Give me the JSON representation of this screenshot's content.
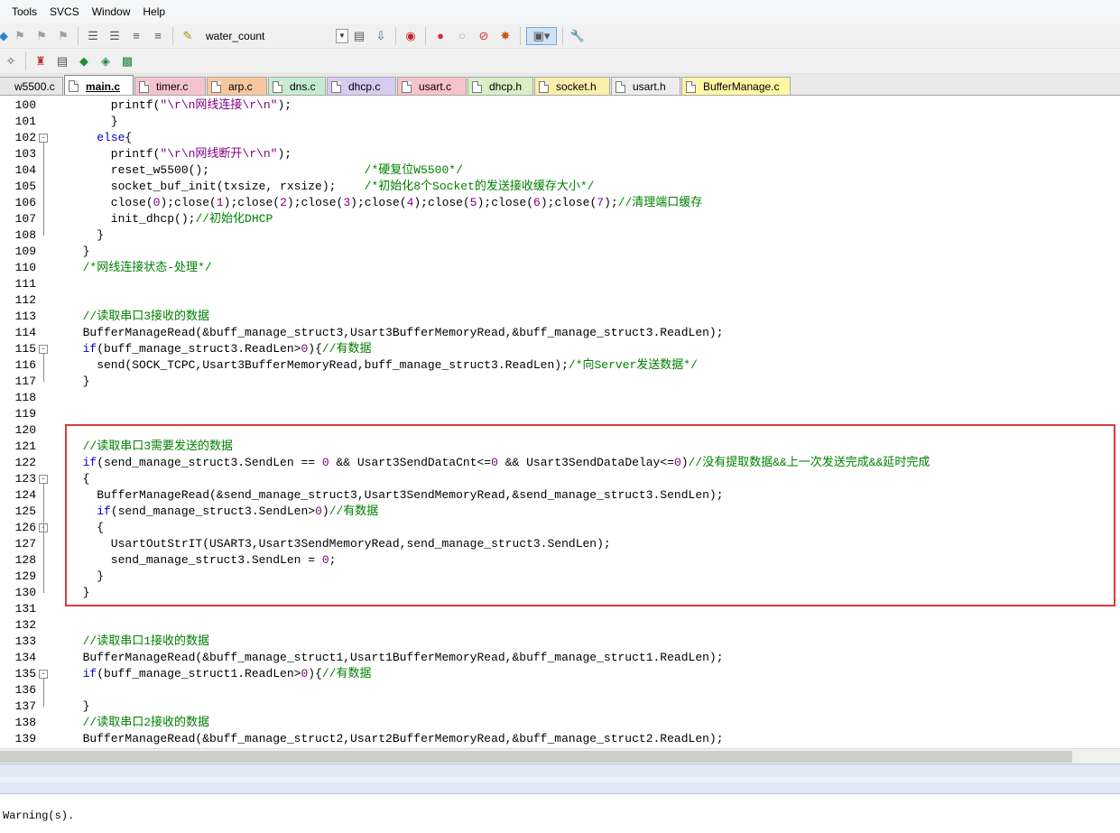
{
  "menu": [
    "Tools",
    "SVCS",
    "Window",
    "Help"
  ],
  "toolbar": {
    "target_name": "water_count"
  },
  "tabs": [
    {
      "label": "w5500.c",
      "color": "#e6e6e6"
    },
    {
      "label": "main.c",
      "color": "#ffffff",
      "active": true
    },
    {
      "label": "timer.c",
      "color": "#f3c4ce"
    },
    {
      "label": "arp.c",
      "color": "#f7c79f"
    },
    {
      "label": "dns.c",
      "color": "#c5ecd1"
    },
    {
      "label": "dhcp.c",
      "color": "#d7cbf0"
    },
    {
      "label": "usart.c",
      "color": "#f7c2c8"
    },
    {
      "label": "dhcp.h",
      "color": "#d8efc5"
    },
    {
      "label": "socket.h",
      "color": "#fbeeaa"
    },
    {
      "label": "usart.h",
      "color": "#ececec"
    },
    {
      "label": "BufferManage.c",
      "color": "#fff7a4"
    }
  ],
  "code": [
    {
      "n": "100",
      "segs": [
        [
          "      printf(",
          ""
        ],
        [
          "\"\\r\\n网线连接\\r\\n\"",
          "st"
        ],
        [
          ");",
          ""
        ]
      ]
    },
    {
      "n": "101",
      "segs": [
        [
          "      }",
          ""
        ]
      ]
    },
    {
      "n": "102",
      "fold": "-",
      "segs": [
        [
          "    ",
          ""
        ],
        [
          "else",
          "kw"
        ],
        [
          "{",
          ""
        ]
      ]
    },
    {
      "n": "103",
      "segs": [
        [
          "      printf(",
          ""
        ],
        [
          "\"\\r\\n网线断开\\r\\n\"",
          "st"
        ],
        [
          ");",
          ""
        ]
      ]
    },
    {
      "n": "104",
      "segs": [
        [
          "      reset_w5500();                      ",
          ""
        ],
        [
          "/*硬复位W5500*/",
          "cm"
        ]
      ]
    },
    {
      "n": "105",
      "segs": [
        [
          "      socket_buf_init(txsize, rxsize);    ",
          ""
        ],
        [
          "/*初始化8个Socket的发送接收缓存大小*/",
          "cm"
        ]
      ]
    },
    {
      "n": "106",
      "segs": [
        [
          "      close(",
          ""
        ],
        [
          "0",
          "nm"
        ],
        [
          ");close(",
          ""
        ],
        [
          "1",
          "nm"
        ],
        [
          ");close(",
          ""
        ],
        [
          "2",
          "nm"
        ],
        [
          ");close(",
          ""
        ],
        [
          "3",
          "nm"
        ],
        [
          ");close(",
          ""
        ],
        [
          "4",
          "nm"
        ],
        [
          ");close(",
          ""
        ],
        [
          "5",
          "nm"
        ],
        [
          ");close(",
          ""
        ],
        [
          "6",
          "nm"
        ],
        [
          ");close(",
          ""
        ],
        [
          "7",
          "nm"
        ],
        [
          ");",
          ""
        ],
        [
          "//清理端口缓存",
          "cm"
        ]
      ]
    },
    {
      "n": "107",
      "segs": [
        [
          "      init_dhcp();",
          ""
        ],
        [
          "//初始化DHCP",
          "cm"
        ]
      ]
    },
    {
      "n": "108",
      "segs": [
        [
          "    }",
          ""
        ]
      ]
    },
    {
      "n": "109",
      "segs": [
        [
          "  }",
          ""
        ]
      ]
    },
    {
      "n": "110",
      "segs": [
        [
          "  ",
          ""
        ],
        [
          "/*网线连接状态-处理*/",
          "cm"
        ]
      ]
    },
    {
      "n": "111",
      "segs": []
    },
    {
      "n": "112",
      "segs": []
    },
    {
      "n": "113",
      "segs": [
        [
          "  ",
          ""
        ],
        [
          "//读取串口3接收的数据",
          "cm"
        ]
      ]
    },
    {
      "n": "114",
      "segs": [
        [
          "  BufferManageRead(&buff_manage_struct3,Usart3BufferMemoryRead,&buff_manage_struct3.ReadLen);",
          ""
        ]
      ]
    },
    {
      "n": "115",
      "fold": "-",
      "segs": [
        [
          "  ",
          ""
        ],
        [
          "if",
          "kw"
        ],
        [
          "(buff_manage_struct3.ReadLen>",
          ""
        ],
        [
          "0",
          "nm"
        ],
        [
          ")",
          ""
        ],
        [
          "{",
          ""
        ],
        [
          "//有数据",
          "cm"
        ]
      ]
    },
    {
      "n": "116",
      "segs": [
        [
          "    send(SOCK_TCPC,Usart3BufferMemoryRead,buff_manage_struct3.ReadLen);",
          ""
        ],
        [
          "/*向Server发送数据*/",
          "cm"
        ]
      ]
    },
    {
      "n": "117",
      "segs": [
        [
          "  }",
          ""
        ]
      ]
    },
    {
      "n": "118",
      "segs": []
    },
    {
      "n": "119",
      "segs": []
    },
    {
      "n": "120",
      "segs": []
    },
    {
      "n": "121",
      "segs": [
        [
          "  ",
          ""
        ],
        [
          "//读取串口3需要发送的数据",
          "cm"
        ]
      ]
    },
    {
      "n": "122",
      "segs": [
        [
          "  ",
          ""
        ],
        [
          "if",
          "kw"
        ],
        [
          "(send_manage_struct3.SendLen == ",
          ""
        ],
        [
          "0",
          "nm"
        ],
        [
          " && Usart3SendDataCnt<=",
          ""
        ],
        [
          "0",
          "nm"
        ],
        [
          " && Usart3SendDataDelay<=",
          ""
        ],
        [
          "0",
          "nm"
        ],
        [
          ")",
          ""
        ],
        [
          "//没有提取数据&&上一次发送完成&&延时完成",
          "cm"
        ]
      ]
    },
    {
      "n": "123",
      "fold": "-",
      "segs": [
        [
          "  {",
          ""
        ]
      ]
    },
    {
      "n": "124",
      "segs": [
        [
          "    BufferManageRead(&send_manage_struct3,Usart3SendMemoryRead,&send_manage_struct3.SendLen);",
          ""
        ]
      ]
    },
    {
      "n": "125",
      "segs": [
        [
          "    ",
          ""
        ],
        [
          "if",
          "kw"
        ],
        [
          "(send_manage_struct3.SendLen>",
          ""
        ],
        [
          "0",
          "nm"
        ],
        [
          ")",
          ""
        ],
        [
          "//有数据",
          "cm"
        ]
      ]
    },
    {
      "n": "126",
      "fold": "-",
      "segs": [
        [
          "    {",
          ""
        ]
      ]
    },
    {
      "n": "127",
      "segs": [
        [
          "      UsartOutStrIT(USART3,Usart3SendMemoryRead,send_manage_struct3.SendLen);",
          ""
        ]
      ]
    },
    {
      "n": "128",
      "segs": [
        [
          "      send_manage_struct3.SendLen = ",
          ""
        ],
        [
          "0",
          "nm"
        ],
        [
          ";",
          ""
        ]
      ]
    },
    {
      "n": "129",
      "segs": [
        [
          "    }",
          ""
        ]
      ]
    },
    {
      "n": "130",
      "segs": [
        [
          "  }",
          ""
        ]
      ]
    },
    {
      "n": "131",
      "segs": []
    },
    {
      "n": "132",
      "segs": []
    },
    {
      "n": "133",
      "segs": [
        [
          "  ",
          ""
        ],
        [
          "//读取串口1接收的数据",
          "cm"
        ]
      ]
    },
    {
      "n": "134",
      "segs": [
        [
          "  BufferManageRead(&buff_manage_struct1,Usart1BufferMemoryRead,&buff_manage_struct1.ReadLen);",
          ""
        ]
      ]
    },
    {
      "n": "135",
      "fold": "-",
      "segs": [
        [
          "  ",
          ""
        ],
        [
          "if",
          "kw"
        ],
        [
          "(buff_manage_struct1.ReadLen>",
          ""
        ],
        [
          "0",
          "nm"
        ],
        [
          ")",
          ""
        ],
        [
          "{",
          ""
        ],
        [
          "//有数据",
          "cm"
        ]
      ]
    },
    {
      "n": "136",
      "segs": []
    },
    {
      "n": "137",
      "segs": [
        [
          "  }",
          ""
        ]
      ]
    },
    {
      "n": "138",
      "segs": [
        [
          "  ",
          ""
        ],
        [
          "//读取串口2接收的数据",
          "cm"
        ]
      ]
    },
    {
      "n": "139",
      "segs": [
        [
          "  BufferManageRead(&buff_manage_struct2,Usart2BufferMemoryRead,&buff_manage_struct2.ReadLen);",
          ""
        ]
      ]
    }
  ],
  "output": {
    "text": "Warning(s)."
  }
}
